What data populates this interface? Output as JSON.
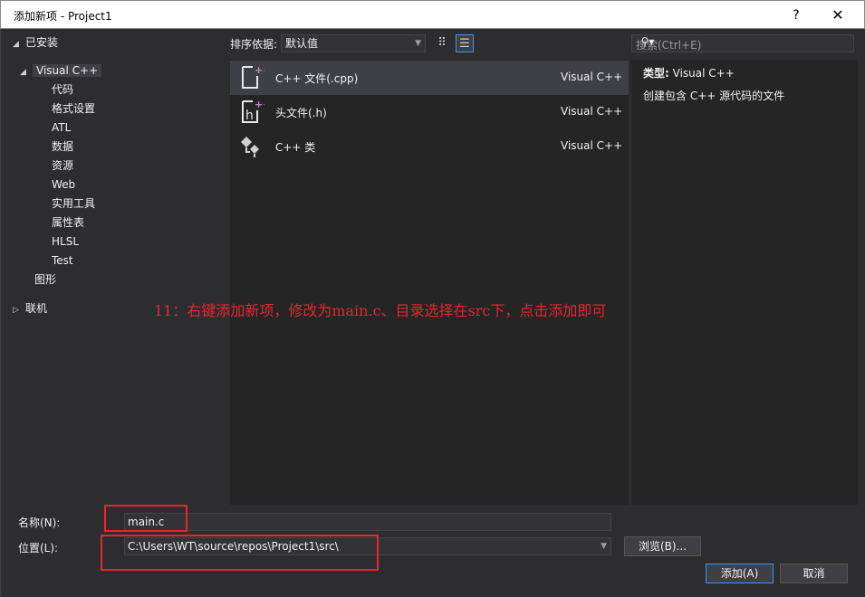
{
  "window": {
    "title": "添加新项 - Project1",
    "help": "?",
    "close": "✕"
  },
  "tree": {
    "installed": "已安装",
    "root": "Visual C++",
    "children": [
      "代码",
      "格式设置",
      "ATL",
      "数据",
      "资源",
      "Web",
      "实用工具",
      "属性表",
      "HLSL",
      "Test"
    ],
    "graphics": "图形",
    "online": "联机"
  },
  "sortbar": {
    "label": "排序依据:",
    "value": "默认值"
  },
  "templates": [
    {
      "name": "C++ 文件(.cpp)",
      "lang": "Visual C++",
      "icon": "cpp-file-icon"
    },
    {
      "name": "头文件(.h)",
      "lang": "Visual C++",
      "icon": "header-file-icon"
    },
    {
      "name": "C++ 类",
      "lang": "Visual C++",
      "icon": "cpp-class-icon"
    }
  ],
  "search": {
    "placeholder": "搜索(Ctrl+E)"
  },
  "details": {
    "type_label": "类型:",
    "type_value": "Visual C++",
    "description": "创建包含 C++ 源代码的文件"
  },
  "annotation": "11：右键添加新项，修改为main.c、目录选择在src下，点击添加即可",
  "form": {
    "name_label": "名称(N):",
    "name_value": "main.c",
    "location_label": "位置(L):",
    "location_value": "C:\\Users\\WT\\source\\repos\\Project1\\src\\",
    "browse": "浏览(B)...",
    "add": "添加(A)",
    "cancel": "取消"
  },
  "colors": {
    "accent": "#3399ff",
    "annotation_red": "#e8262a",
    "background": "#2d2d30"
  }
}
